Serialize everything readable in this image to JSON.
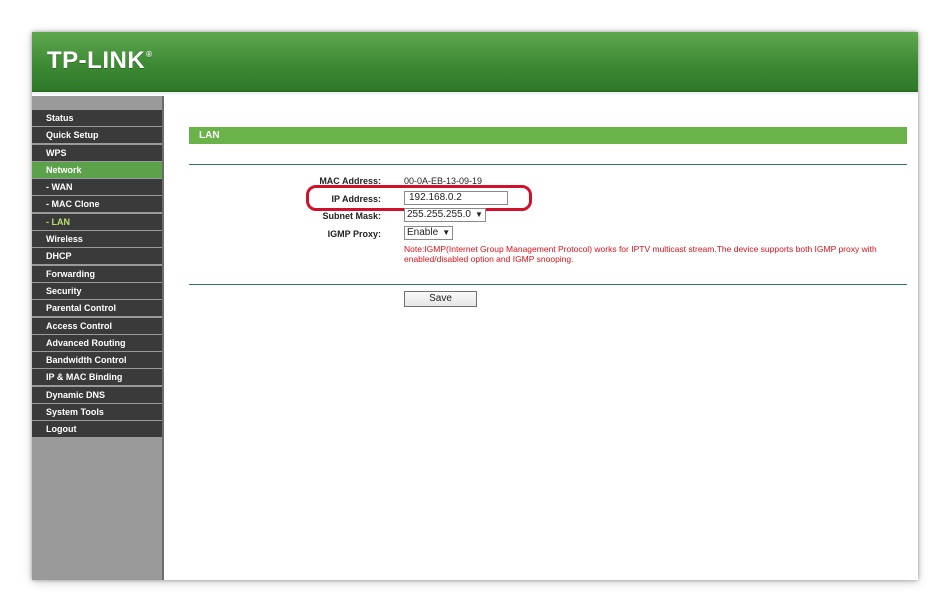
{
  "header": {
    "logo": "TP-LINK",
    "logo_mark": "®"
  },
  "sidebar": {
    "items": [
      {
        "label": "Status"
      },
      {
        "label": "Quick Setup"
      },
      {
        "label": "WPS"
      },
      {
        "label": "Network",
        "state": "active"
      },
      {
        "label": "- WAN"
      },
      {
        "label": "- MAC Clone"
      },
      {
        "label": "- LAN",
        "state": "selected"
      },
      {
        "label": "Wireless"
      },
      {
        "label": "DHCP"
      },
      {
        "label": "Forwarding"
      },
      {
        "label": "Security"
      },
      {
        "label": "Parental Control"
      },
      {
        "label": "Access Control"
      },
      {
        "label": "Advanced Routing"
      },
      {
        "label": "Bandwidth Control"
      },
      {
        "label": "IP & MAC Binding"
      },
      {
        "label": "Dynamic DNS"
      },
      {
        "label": "System Tools"
      },
      {
        "label": "Logout"
      }
    ]
  },
  "main": {
    "section_title": "LAN",
    "mac_label": "MAC Address:",
    "mac_value": "00-0A-EB-13-09-19",
    "ip_label": "IP Address:",
    "ip_value": "192.168.0.2",
    "subnet_label": "Subnet Mask:",
    "subnet_value": "255.255.255.0",
    "igmp_label": "IGMP Proxy:",
    "igmp_value": "Enable",
    "note": "Note:IGMP(Internet Group Management Protocol) works for IPTV multicast stream.The device supports both IGMP proxy with enabled/disabled option and IGMP snooping.",
    "save_label": "Save"
  },
  "colors": {
    "header_green": "#3f8a35",
    "section_green": "#6ab34a",
    "menu_dark": "#3a3a3a",
    "menu_active": "#5ba24b",
    "highlight_red": "#d0112b",
    "note_red": "#e0121b"
  }
}
